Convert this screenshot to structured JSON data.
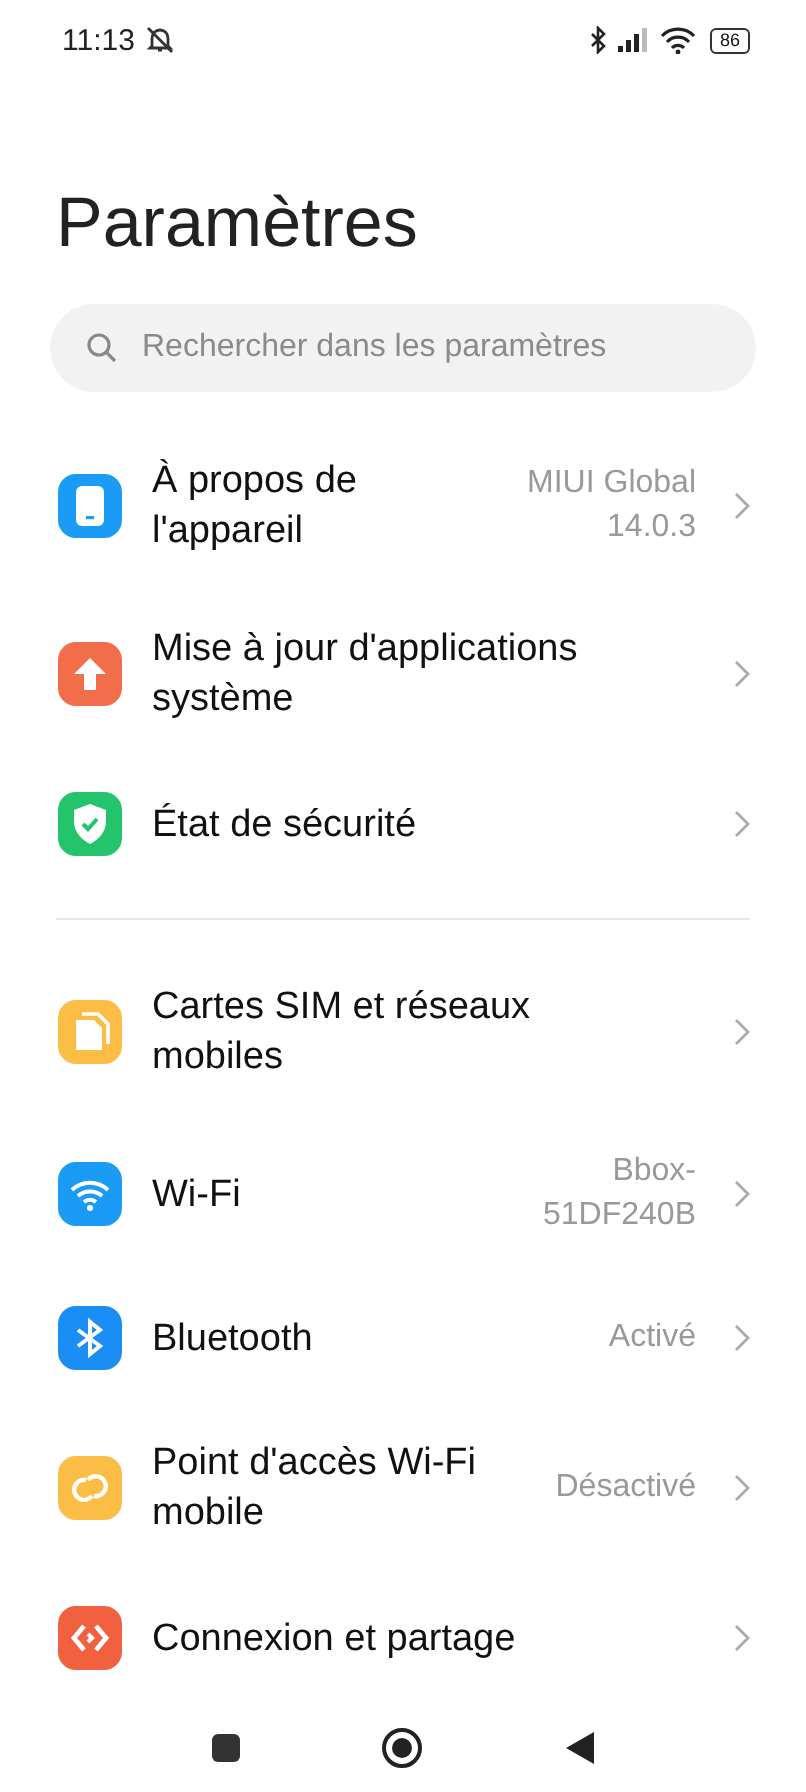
{
  "status_bar": {
    "time": "11:13",
    "battery": "86"
  },
  "title": "Paramètres",
  "search": {
    "placeholder": "Rechercher dans les paramètres"
  },
  "sections": [
    {
      "items": [
        {
          "kind": "phone",
          "color": "#1a9bf5",
          "label": "À propos de l'appareil",
          "value": "MIUI Global 14.0.3"
        },
        {
          "kind": "update",
          "color": "#f26d4a",
          "label": "Mise à jour d'applications système"
        },
        {
          "kind": "shield",
          "color": "#24c46c",
          "label": "État de sécurité"
        }
      ]
    },
    {
      "items": [
        {
          "kind": "sim",
          "color": "#fbbd45",
          "label": "Cartes SIM et réseaux mobiles"
        },
        {
          "kind": "wifi",
          "color": "#1a9bf5",
          "label": "Wi-Fi",
          "value": "Bbox-51DF240B"
        },
        {
          "kind": "bluetooth",
          "color": "#1a8ef5",
          "label": "Bluetooth",
          "value": "Activé"
        },
        {
          "kind": "hotspot",
          "color": "#fbbd45",
          "label": "Point d'accès Wi-Fi mobile",
          "value": "Désactivé"
        },
        {
          "kind": "share",
          "color": "#f2613f",
          "label": "Connexion et partage"
        }
      ]
    }
  ]
}
